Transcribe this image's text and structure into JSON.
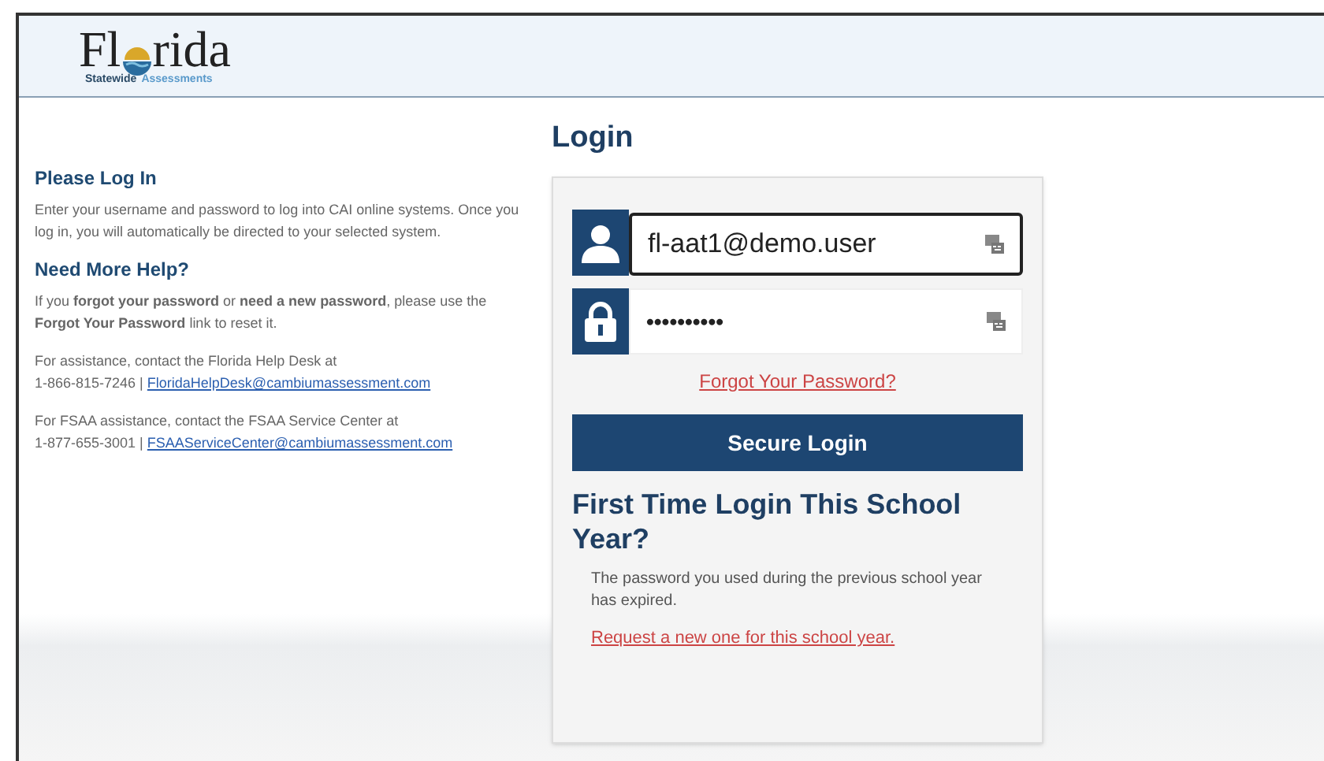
{
  "logo": {
    "title_before_mark": "Fl",
    "title_after_mark": "rida",
    "subtitle_first": "Statewide",
    "subtitle_second": "Assessments"
  },
  "help": {
    "heading": "Please Log In",
    "intro": "Enter your username and password to log into CAI online systems. Once you log in, you will automatically be directed to your selected system.",
    "more_heading": "Need More Help?",
    "forgot_text": "If you **forgot your password** or **need a new password**, please use the **Forgot Your Password** link to reset it.",
    "contacts": [
      {
        "text": "For assistance, contact the Florida Help Desk at",
        "phone": "1-866-815-7246 |",
        "email": "FloridaHelpDesk@cambiumassessment.com"
      },
      {
        "text": "For FSAA assistance, contact the FSAA Service Center at",
        "phone": "1-877-655-3001 |",
        "email": "FSAAServiceCenter@cambiumassessment.com"
      }
    ]
  },
  "login": {
    "title": "Login",
    "fields": [
      {
        "kind": "user",
        "value": "fl-aat1@demo.user",
        "focused": true
      },
      {
        "kind": "password",
        "value": "••••••••••",
        "focused": false
      }
    ],
    "forgot_link": "Forgot Your Password?",
    "submit": "Secure Login",
    "first_time_heading": "First Time Login This School Year?",
    "first_time_text": "The password you used during the previous school year has expired.",
    "request_link": "Request a new one for this school year."
  }
}
